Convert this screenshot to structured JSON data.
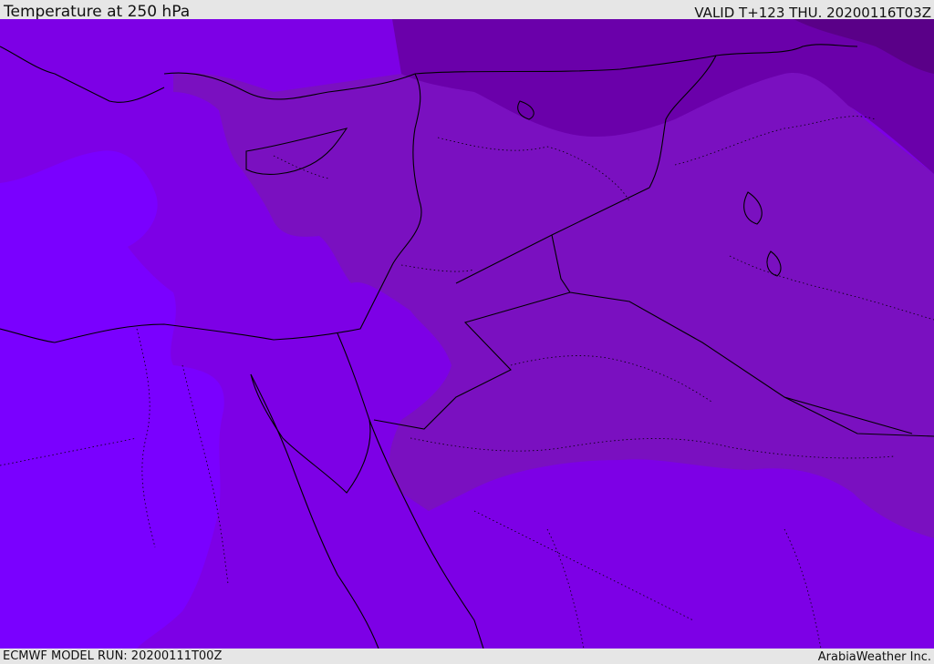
{
  "header": {
    "title": "Temperature at 250 hPa",
    "valid": "VALID T+123 THU. 20200116T03Z"
  },
  "footer": {
    "model_run": "ECMWF MODEL RUN: 20200111T00Z",
    "credit": "ArabiaWeather Inc."
  },
  "map": {
    "colors": {
      "band_warmest": "#7a00ff",
      "band_warm": "#7d00e6",
      "band_mid": "#7a10c0",
      "band_cool": "#6a00aa",
      "band_coolest": "#5a0088",
      "border": "#000000"
    }
  }
}
